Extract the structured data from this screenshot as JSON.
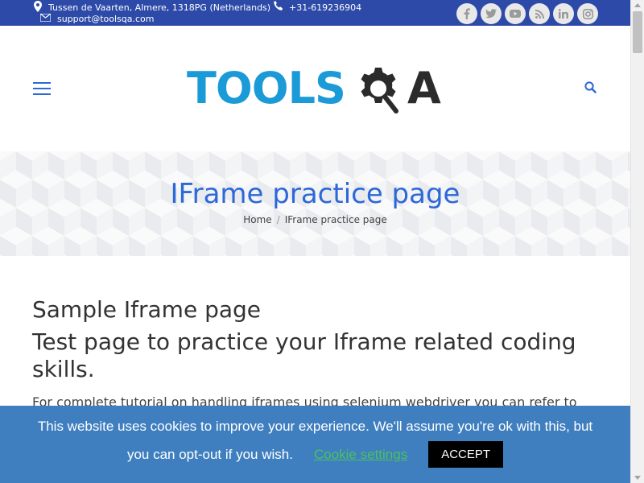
{
  "topbar": {
    "address": "Tussen de Vaarten, Almere, 1318PG (Netherlands)",
    "phone": "+31-619236904",
    "email": "support@toolsqa.com",
    "social": [
      "facebook-icon",
      "twitter-icon",
      "youtube-icon",
      "rss-icon",
      "linkedin-icon",
      "instagram-icon"
    ]
  },
  "header": {
    "logo_text_left": "TOOLS",
    "logo_text_right": "A",
    "logo_colors": {
      "tools": "#1a9ad6",
      "gear": "#2b2b2b"
    }
  },
  "banner": {
    "title": "IFrame practice page",
    "breadcrumb": [
      "Home",
      "IFrame practice page"
    ]
  },
  "content": {
    "heading": "Sample Iframe page",
    "subheading": "Test page to practice your Iframe related coding skills.",
    "paragraph": "For complete tutorial on handling iframes using selenium webdriver you can refer to"
  },
  "cookie": {
    "message": "This website uses cookies to improve your experience. We'll assume you're ok with this, but",
    "message2": "you can opt-out if you wish.",
    "settings_label": "Cookie settings",
    "accept_label": "ACCEPT"
  },
  "colors": {
    "accent": "#2d68d8",
    "topbar": "#2d4aa8",
    "cookie_bg": "#3f7fbf",
    "cookie_link": "#49c25d"
  }
}
